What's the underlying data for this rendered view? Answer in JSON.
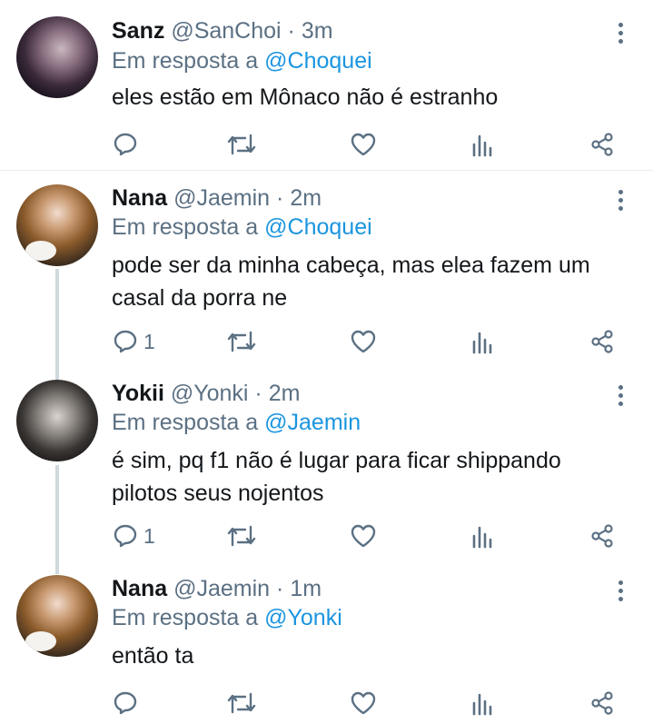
{
  "reply_prefix": "Em resposta a",
  "tweets": [
    {
      "name": "Sanz",
      "handle": "@SanChoi",
      "time": "3m",
      "reply_to": "@Choquei",
      "lines": [
        "eles estão em Mônaco não é estranho"
      ],
      "reply_count": ""
    },
    {
      "name": "Nana",
      "handle": "@Jaemin",
      "time": "2m",
      "reply_to": "@Choquei",
      "lines": [
        "pode ser da minha cabeça, mas elea fazem um",
        "casal da porra ne"
      ],
      "reply_count": "1"
    },
    {
      "name": "Yokii",
      "handle": "@Yonki",
      "time": "2m",
      "reply_to": "@Jaemin",
      "lines": [
        "é sim, pq f1 não é lugar para ficar shippando",
        "pilotos seus nojentos"
      ],
      "reply_count": "1"
    },
    {
      "name": "Nana",
      "handle": "@Jaemin",
      "time": "1m",
      "reply_to": "@Yonki",
      "lines": [
        "então ta"
      ],
      "reply_count": ""
    }
  ],
  "separator": "·",
  "colors": {
    "mention": "#1b95e0",
    "secondary": "#5b7083",
    "text": "#14171a",
    "thread_line": "#cfd9de"
  },
  "icons": [
    "reply-icon",
    "retweet-icon",
    "like-icon",
    "analytics-icon",
    "share-icon",
    "more-icon"
  ]
}
